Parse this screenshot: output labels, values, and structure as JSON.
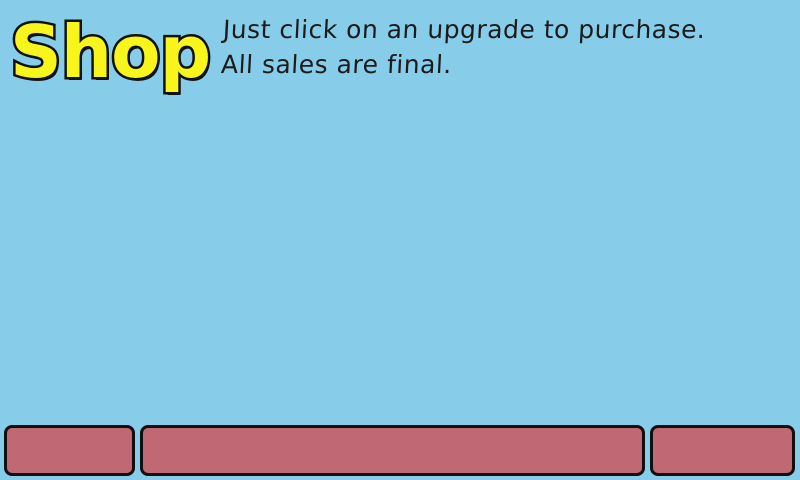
{
  "header": {
    "title": "Shop",
    "instructions": [
      "Just click on an upgrade to purchase.",
      "All sales are final."
    ]
  },
  "bottom_bar": {
    "left_label": "",
    "middle_label": "",
    "right_label": ""
  },
  "colors": {
    "background": "#87cdea",
    "title_fill": "#f8f51c",
    "title_outline": "#111111",
    "button_fill": "#c06873",
    "button_border": "#101010"
  }
}
